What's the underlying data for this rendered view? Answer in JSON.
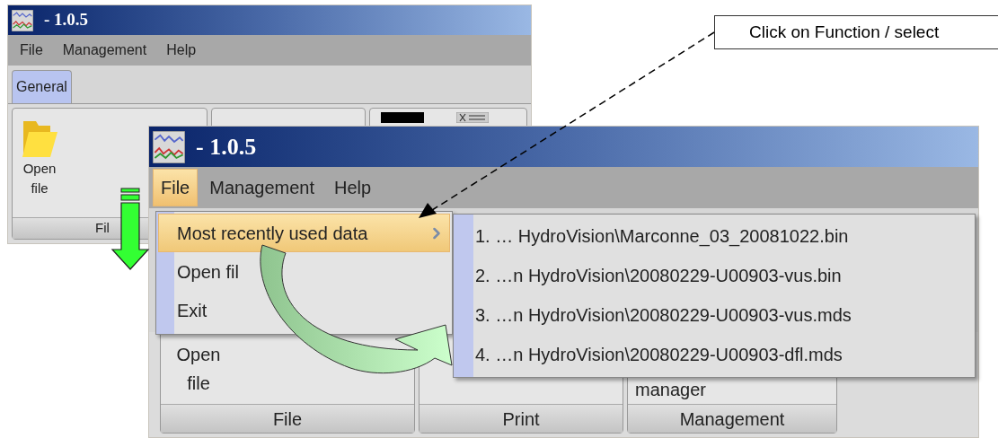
{
  "back_window": {
    "title": "- 1.0.5",
    "menu": [
      {
        "label": "File",
        "selected": false
      },
      {
        "label": "Management",
        "selected": false
      },
      {
        "label": "Help",
        "selected": false
      }
    ],
    "tabs": [
      {
        "label": "General",
        "selected": true
      }
    ],
    "groups": [
      {
        "button": "Open file",
        "footer": "Fil"
      }
    ]
  },
  "front_window": {
    "title": "- 1.0.5",
    "menu": [
      {
        "label": "File",
        "selected": true
      },
      {
        "label": "Management",
        "selected": false
      },
      {
        "label": "Help",
        "selected": false
      }
    ],
    "file_menu": [
      {
        "label": "Most recently used data",
        "kind": "submenu",
        "selected": true
      },
      {
        "label": "Open fil",
        "kind": "item",
        "selected": false
      },
      {
        "label": "Exit",
        "kind": "item",
        "selected": false
      }
    ],
    "recent_files": [
      "1. … HydroVision\\Marconne_03_20081022.bin",
      "2. …n HydroVision\\20080229-U00903-vus.bin",
      "3. …n HydroVision\\20080229-U00903-vus.mds",
      "4. …n HydroVision\\20080229-U00903-dfl.mds"
    ],
    "groups": [
      {
        "button": "Open file",
        "footer": "File"
      },
      {
        "footer": "Print"
      },
      {
        "button": "manager",
        "footer": "Management"
      }
    ]
  },
  "callout": {
    "text": "Click on Function / select"
  }
}
